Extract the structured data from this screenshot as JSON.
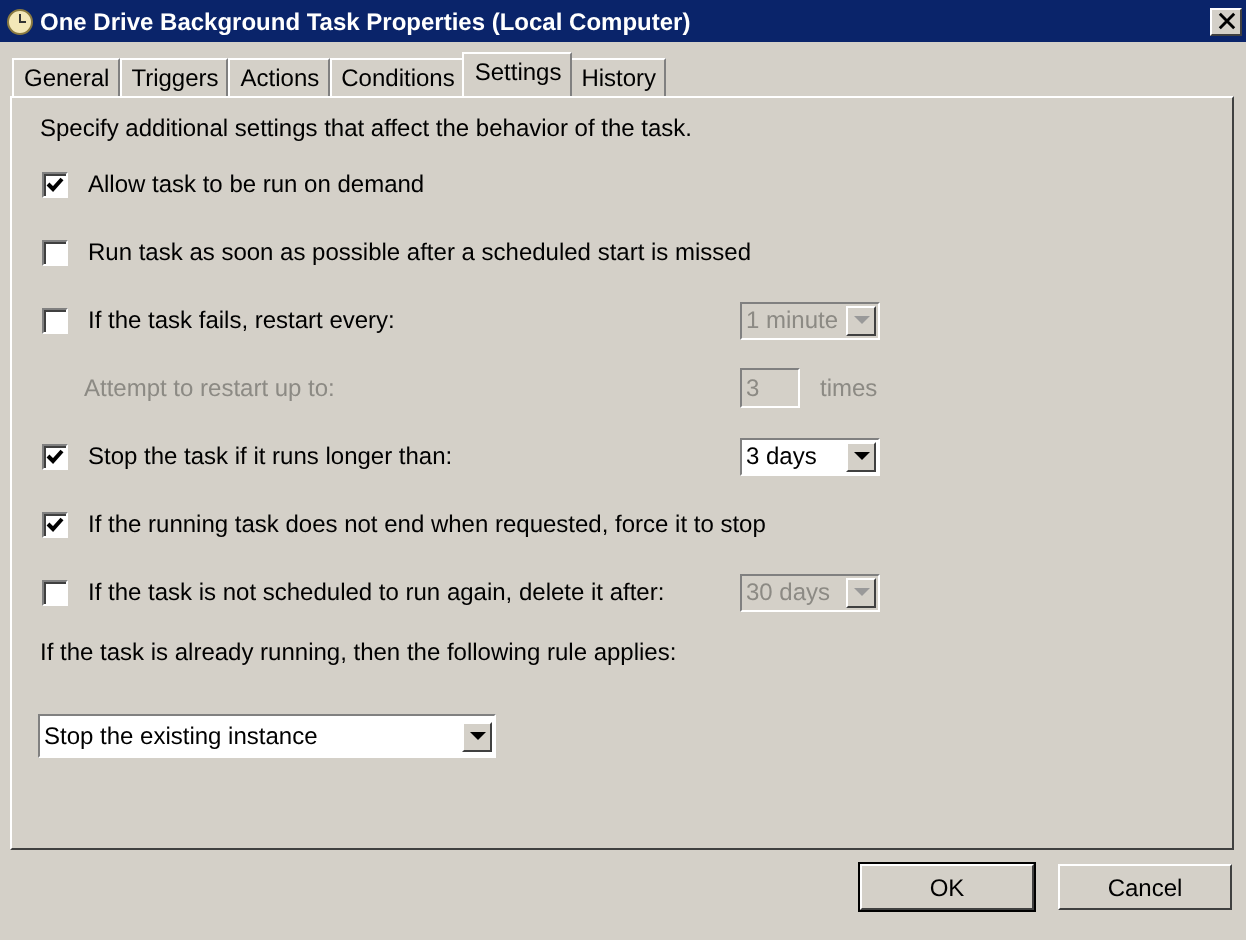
{
  "window": {
    "title": "One Drive  Background Task Properties (Local Computer)"
  },
  "tabs": [
    {
      "label": "General",
      "selected": false
    },
    {
      "label": "Triggers",
      "selected": false
    },
    {
      "label": "Actions",
      "selected": false
    },
    {
      "label": "Conditions",
      "selected": false
    },
    {
      "label": "Settings",
      "selected": true
    },
    {
      "label": "History",
      "selected": false
    }
  ],
  "intro": "Specify additional settings that affect the behavior of the task.",
  "settings": [
    {
      "kind": "checkbox",
      "label": "Allow task to be run on demand",
      "checked": true
    },
    {
      "kind": "checkbox",
      "label": "Run task as soon as possible after a scheduled start is missed",
      "checked": false
    },
    {
      "kind": "checkbox",
      "label": "If the task fails, restart every:",
      "checked": false,
      "dropdown": {
        "value": "1 minute",
        "disabled": true
      }
    },
    {
      "kind": "count",
      "label": "Attempt to restart up to:",
      "disabled": true,
      "value": "3",
      "suffix": "times"
    },
    {
      "kind": "checkbox",
      "label": "Stop the task if it runs longer than:",
      "checked": true,
      "dropdown": {
        "value": "3 days",
        "disabled": false
      }
    },
    {
      "kind": "checkbox",
      "label": "If the running task does not end when requested, force it to stop",
      "checked": true
    },
    {
      "kind": "checkbox",
      "label": "If the task is not scheduled to run again, delete it after:",
      "checked": false,
      "dropdown": {
        "value": "30 days",
        "disabled": true
      }
    }
  ],
  "rule": {
    "label": "If the task is already running, then the following rule applies:",
    "value": "Stop the existing instance"
  },
  "buttons": [
    "OK",
    "Cancel"
  ]
}
